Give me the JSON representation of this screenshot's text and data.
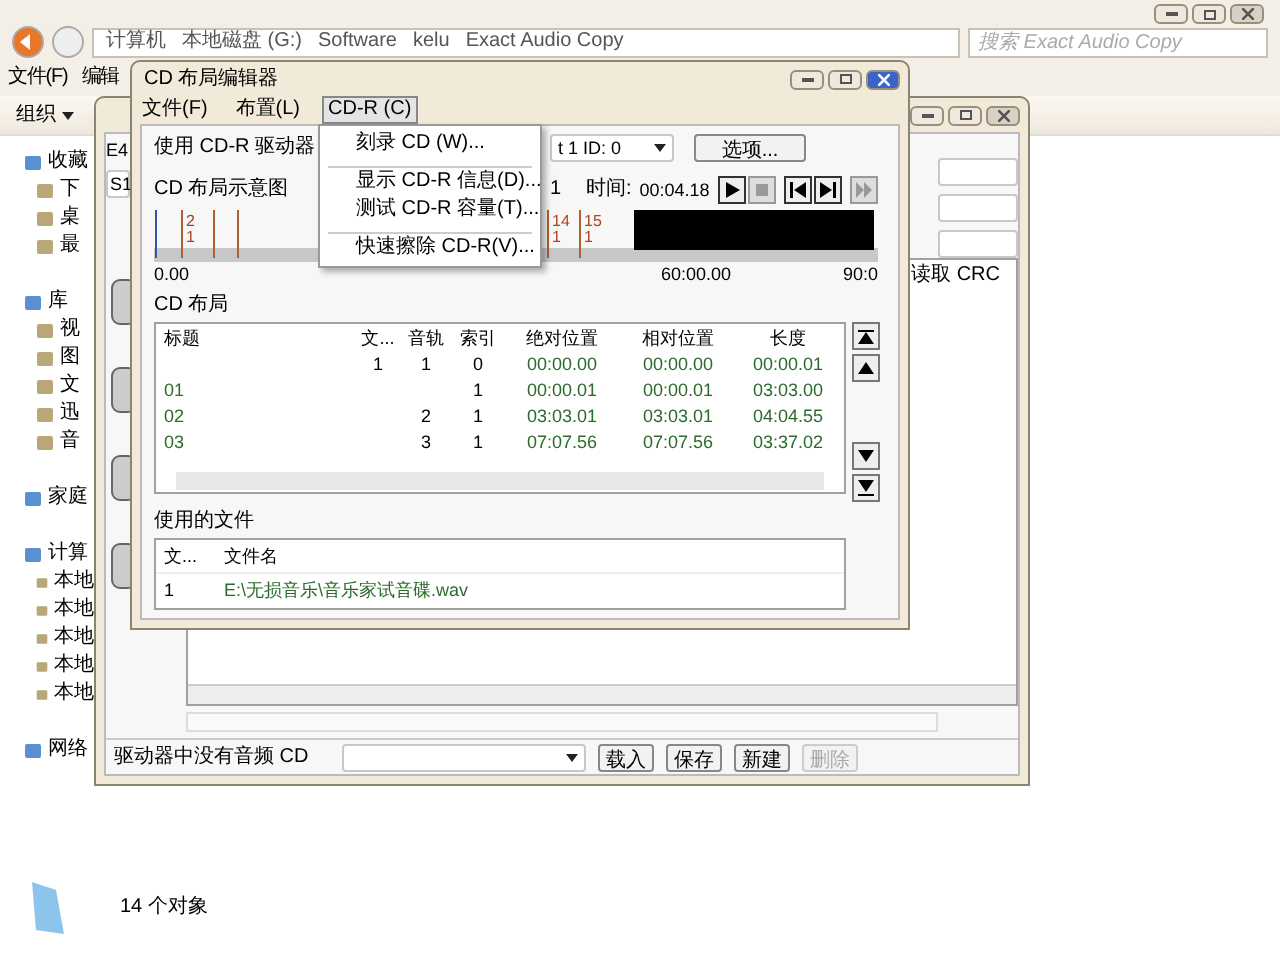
{
  "explorer": {
    "breadcrumb": [
      "计算机",
      "本地磁盘 (G:)",
      "Software",
      "kelu",
      "Exact Audio Copy"
    ],
    "search": {
      "placeholder": "搜索 Exact Audio Copy"
    },
    "menu": [
      "文件(F)",
      "编辑"
    ],
    "organize": "组织",
    "nav": [
      {
        "label": "收藏",
        "children": [
          {
            "label": "下"
          },
          {
            "label": "桌"
          },
          {
            "label": "最"
          }
        ]
      },
      {
        "label": "库",
        "children": [
          {
            "label": "视"
          },
          {
            "label": "图"
          },
          {
            "label": "文"
          },
          {
            "label": "迅"
          },
          {
            "label": "音"
          }
        ]
      },
      {
        "label": "家庭"
      },
      {
        "label": "计算",
        "children": [
          {
            "label": "本地"
          },
          {
            "label": "本地"
          },
          {
            "label": "本地"
          },
          {
            "label": "本地"
          },
          {
            "label": "本地"
          }
        ]
      },
      {
        "label": "网络"
      }
    ],
    "status": "14 个对象"
  },
  "main_window": {
    "label": "E4",
    "field": "S1",
    "list_header": "读取 CRC",
    "status_text": "驱动器中没有音频 CD",
    "buttons": [
      {
        "label": "载入",
        "disabled": false
      },
      {
        "label": "保存",
        "disabled": false
      },
      {
        "label": "新建",
        "disabled": false
      },
      {
        "label": "删除",
        "disabled": true
      }
    ]
  },
  "editor": {
    "title": "CD 布局编辑器",
    "menu": [
      {
        "label": "文件(F)",
        "selected": false
      },
      {
        "label": "布置(L)",
        "selected": false
      },
      {
        "label": "CD-R (C)",
        "selected": true
      }
    ],
    "dropdown": [
      {
        "label": "刻录 CD (W)...",
        "separator_after": true
      },
      {
        "label": "显示 CD-R 信息(D)...",
        "separator_after": false
      },
      {
        "label": "测试 CD-R 容量(T)...",
        "separator_after": true
      },
      {
        "label": "快速擦除 CD-R(V)...",
        "separator_after": false
      }
    ],
    "drive_label": "使用 CD-R 驱动器",
    "drive_value": "t 1 ID: 0",
    "options_button": "选项...",
    "diagram_label": "CD 布局示意图",
    "track_number": "1",
    "time_label": "时间:",
    "time_value": "00:04.18",
    "transport": [
      {
        "kind": "play",
        "disabled": false
      },
      {
        "kind": "stop",
        "disabled": true
      },
      {
        "kind": "prev",
        "disabled": false
      },
      {
        "kind": "next",
        "disabled": false
      },
      {
        "kind": "forward",
        "disabled": true
      }
    ],
    "markers": [
      {
        "track": "2",
        "index": "1"
      },
      {
        "track": "14",
        "index": "1"
      },
      {
        "track": "15",
        "index": "1"
      }
    ],
    "scale": [
      "0.00",
      "60:00.00",
      "90:0"
    ],
    "layout_label": "CD 布局",
    "columns": [
      "标题",
      "文...",
      "音轨",
      "索引",
      "绝对位置",
      "相对位置",
      "长度"
    ],
    "rows": [
      [
        "",
        "1",
        "1",
        "0",
        "00:00.00",
        "00:00.00",
        "00:00.01"
      ],
      [
        "01",
        "",
        "",
        "1",
        "00:00.01",
        "00:00.01",
        "03:03.00"
      ],
      [
        "02",
        "",
        "2",
        "1",
        "03:03.01",
        "03:03.01",
        "04:04.55"
      ],
      [
        "03",
        "",
        "3",
        "1",
        "07:07.56",
        "07:07.56",
        "03:37.02"
      ]
    ],
    "files_label": "使用的文件",
    "file_columns": [
      "文...",
      "文件名"
    ],
    "files": [
      [
        "1",
        "E:\\无损音乐\\音乐家试音碟.wav"
      ]
    ]
  }
}
